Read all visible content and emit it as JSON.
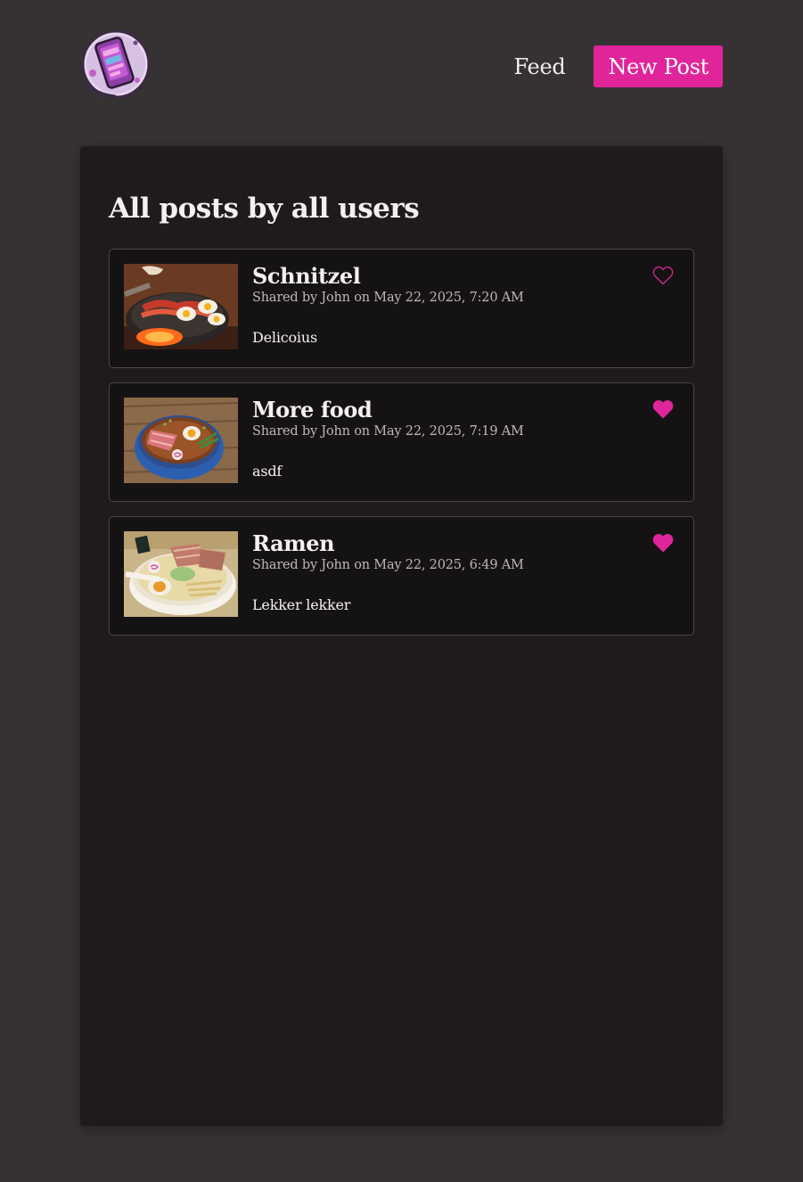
{
  "nav": {
    "feed_label": "Feed",
    "new_post_label": "New Post"
  },
  "page": {
    "title": "All posts by all users"
  },
  "posts": [
    {
      "title": "Schnitzel",
      "meta": "Shared by John on May 22, 2025, 7:20 AM",
      "body": "Delicoius",
      "liked": false,
      "image_icon": "bacon-eggs-pan-image"
    },
    {
      "title": "More food",
      "meta": "Shared by John on May 22, 2025, 7:19 AM",
      "body": "asdf",
      "liked": true,
      "image_icon": "ramen-bowl-image"
    },
    {
      "title": "Ramen",
      "meta": "Shared by John on May 22, 2025, 6:49 AM",
      "body": "Lekker lekker",
      "liked": true,
      "image_icon": "ramen-plate-image"
    }
  ],
  "colors": {
    "accent": "#e0259a",
    "background": "#363234",
    "card": "#1f1b1d",
    "post": "#141213"
  }
}
